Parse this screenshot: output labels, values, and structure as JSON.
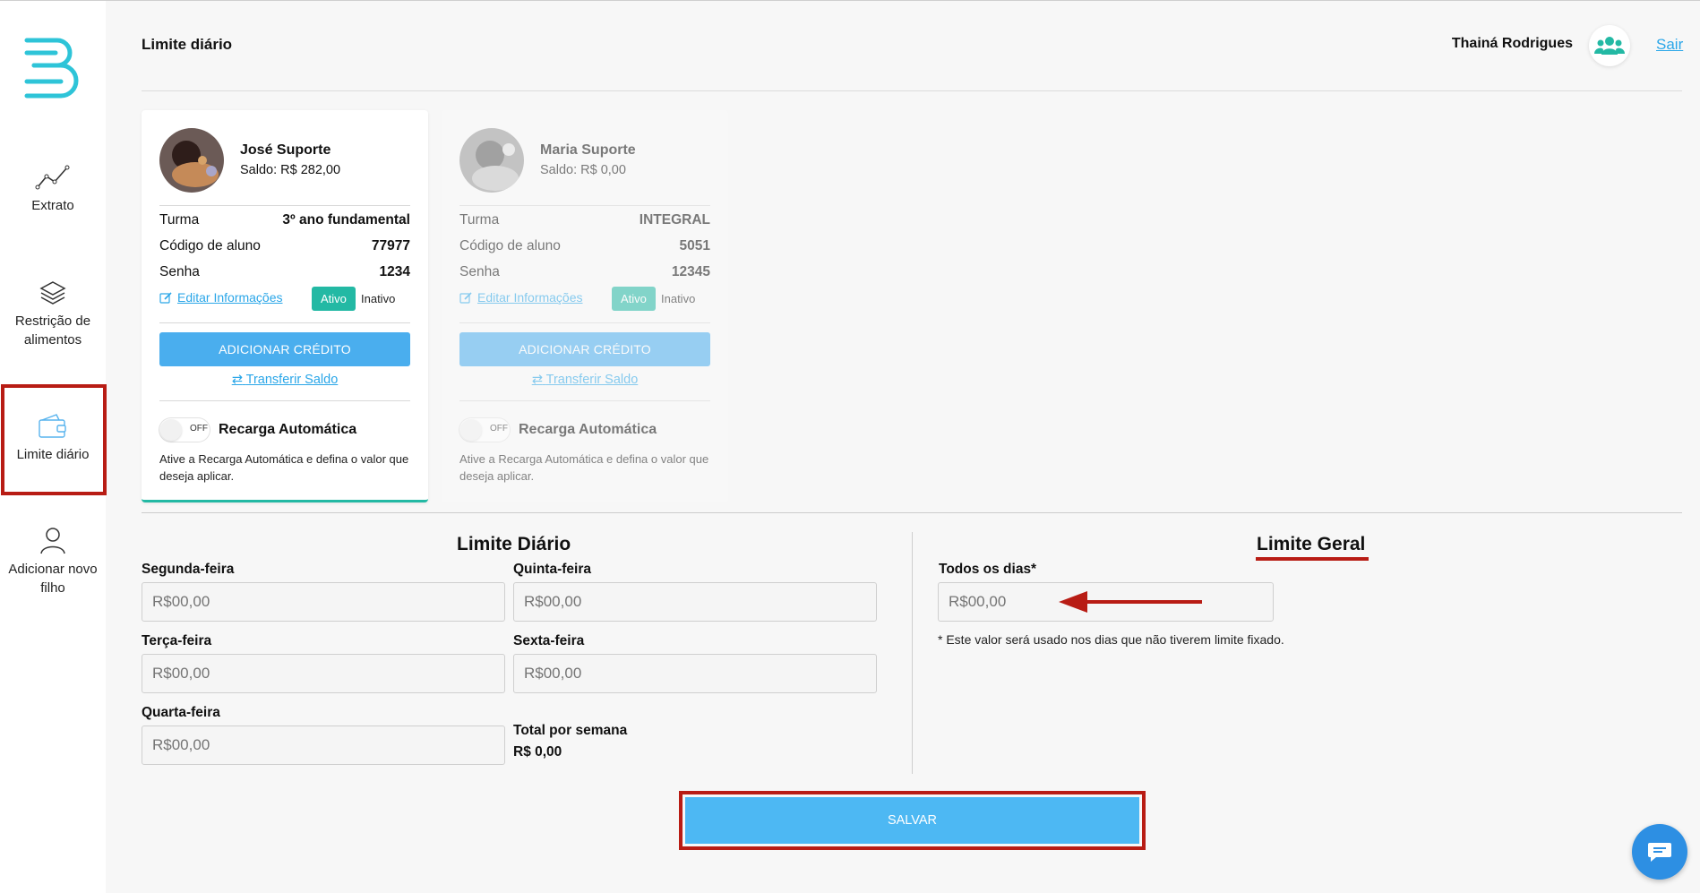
{
  "colors": {
    "accent": "#4aaeee",
    "active_badge": "#23b9a4",
    "annotation_red": "#b81c14",
    "link": "#2aa6e8"
  },
  "sidebar": {
    "items": [
      {
        "label": "Extrato",
        "icon": "line-chart-icon"
      },
      {
        "label": "Restrição de alimentos",
        "icon": "layers-icon"
      },
      {
        "label": "Limite diário",
        "icon": "wallet-icon"
      },
      {
        "label": "Adicionar novo filho",
        "icon": "user-icon"
      }
    ]
  },
  "header": {
    "title": "Limite diário",
    "user_name": "Thainá Rodrigues",
    "logout": "Sair"
  },
  "students": [
    {
      "name": "José Suporte",
      "balance": "Saldo: R$ 282,00",
      "turma_label": "Turma",
      "turma": "3º ano fundamental",
      "codigo_label": "Código de aluno",
      "codigo": "77977",
      "senha_label": "Senha",
      "senha": "1234",
      "edit_link": "Editar Informações",
      "status_on": "Ativo",
      "status_off": "Inativo",
      "credit_button": "ADICIONAR CRÉDITO",
      "transfer_link": "Transferir Saldo",
      "toggle_label": "OFF",
      "recharge_title": "Recarga Automática",
      "recharge_desc": "Ative a Recarga Automática e defina o valor que deseja aplicar."
    },
    {
      "name": "Maria Suporte",
      "balance": "Saldo: R$ 0,00",
      "turma_label": "Turma",
      "turma": "INTEGRAL",
      "codigo_label": "Código de aluno",
      "codigo": "5051",
      "senha_label": "Senha",
      "senha": "12345",
      "edit_link": "Editar Informações",
      "status_on": "Ativo",
      "status_off": "Inativo",
      "credit_button": "ADICIONAR CRÉDITO",
      "transfer_link": "Transferir Saldo",
      "toggle_label": "OFF",
      "recharge_title": "Recarga Automática",
      "recharge_desc": "Ative a Recarga Automática e defina o valor que deseja aplicar."
    }
  ],
  "daily_limit": {
    "title": "Limite Diário",
    "days": [
      {
        "label": "Segunda-feira",
        "placeholder": "R$00,00"
      },
      {
        "label": "Quinta-feira",
        "placeholder": "R$00,00"
      },
      {
        "label": "Terça-feira",
        "placeholder": "R$00,00"
      },
      {
        "label": "Sexta-feira",
        "placeholder": "R$00,00"
      },
      {
        "label": "Quarta-feira",
        "placeholder": "R$00,00"
      }
    ],
    "total_label": "Total por semana",
    "total_value": "R$ 0,00"
  },
  "general_limit": {
    "title": "Limite Geral",
    "field_label": "Todos os dias*",
    "placeholder": "R$00,00",
    "note": "* Este valor será usado nos dias que não tiverem limite fixado."
  },
  "save_button": "SALVAR"
}
